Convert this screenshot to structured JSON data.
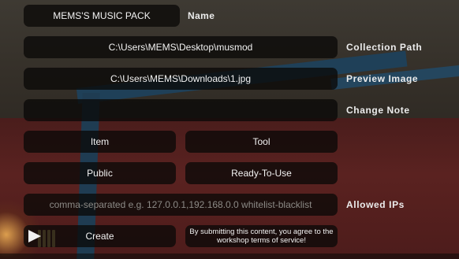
{
  "form": {
    "name": {
      "value": "MEMS'S MUSIC PACK",
      "label": "Name"
    },
    "collection_path": {
      "value": "C:\\Users\\MEMS\\Desktop\\musmod",
      "label": "Collection Path"
    },
    "preview_image": {
      "value": "C:\\Users\\MEMS\\Downloads\\1.jpg",
      "label": "Preview Image"
    },
    "change_note": {
      "value": "",
      "label": "Change Note"
    },
    "type_button": "Item",
    "category_button": "Tool",
    "visibility_button": "Public",
    "status_button": "Ready-To-Use",
    "allowed_ips": {
      "placeholder": "comma-separated e.g. 127.0.0.1,192.168.0.0 whitelist-blacklist",
      "label": "Allowed IPs"
    },
    "create_button": "Create",
    "terms_notice": "By submitting this content, you agree to the workshop terms of service!"
  },
  "icons": {
    "play": "play-icon"
  }
}
